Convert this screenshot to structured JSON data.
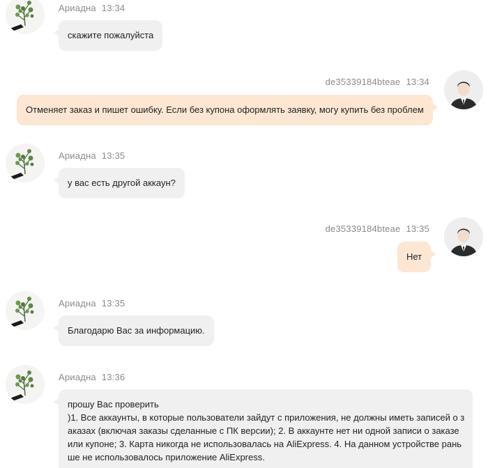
{
  "colors": {
    "incoming_bubble": "#f0f0f0",
    "outgoing_bubble": "#fde7d2",
    "meta_text": "#8a8a8a"
  },
  "icons": {
    "agent_avatar": "plant-icon",
    "user_avatar": "person-icon"
  },
  "messages": [
    {
      "sender": "Ариадна",
      "time": "13:34",
      "direction": "in",
      "lines": [
        "скажите пожалуйста"
      ]
    },
    {
      "sender": "de35339184bteae",
      "time": "13:34",
      "direction": "out",
      "lines": [
        "Отменяет заказ и пишет ошибку. Если без купона оформлять заявку, могу купить без проблем"
      ]
    },
    {
      "sender": "Ариадна",
      "time": "13:35",
      "direction": "in",
      "lines": [
        "у вас есть другой аккаун?"
      ]
    },
    {
      "sender": "de35339184bteae",
      "time": "13:35",
      "direction": "out",
      "lines": [
        "Нет"
      ]
    },
    {
      "sender": "Ариадна",
      "time": "13:35",
      "direction": "in",
      "lines": [
        "Благодарю Вас за информацию."
      ]
    },
    {
      "sender": "Ариадна",
      "time": "13:36",
      "direction": "in",
      "lines": [
        "прошу Вас проверить",
        ")1. Все аккаунты, в которые пользователи зайдут с приложения, не должны иметь записей о з",
        "аказах (включая заказы сделанные с ПК версии); 2. В аккаунте нет ни одной записи о заказе",
        "или купоне; 3. Карта никогда не использовалась на AliExpress. 4. На данном устройстве рань",
        "ше не использовалось приложение AliExpress."
      ]
    }
  ]
}
